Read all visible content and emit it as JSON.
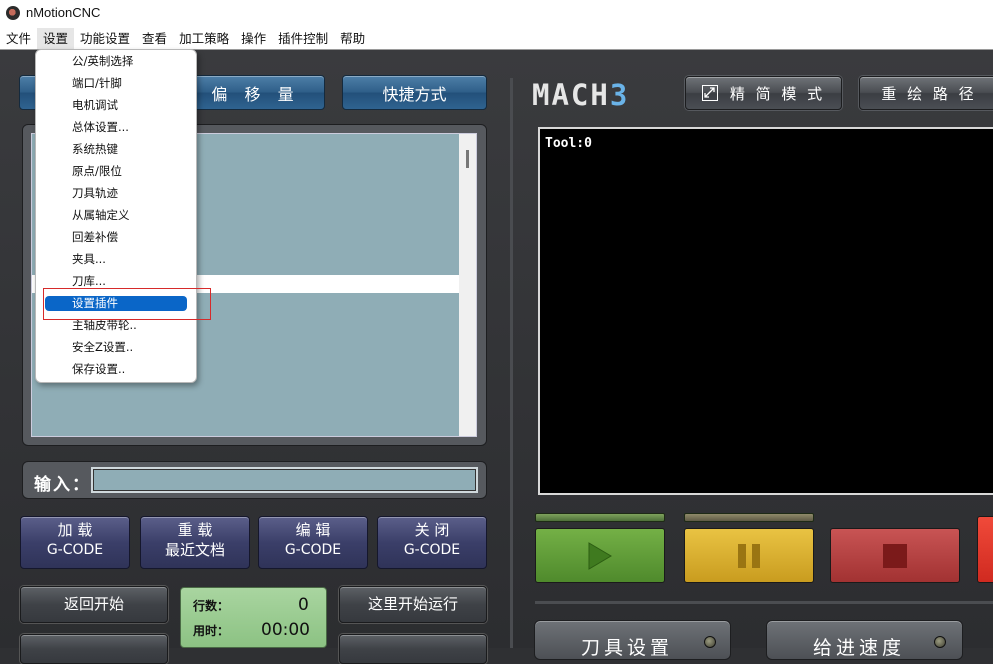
{
  "app": {
    "title": "nMotionCNC"
  },
  "menubar": {
    "items": [
      "文件",
      "设置",
      "功能设置",
      "查看",
      "加工策略",
      "操作",
      "插件控制",
      "帮助"
    ]
  },
  "settings_menu": {
    "items": [
      "公/英制选择",
      "端口/针脚",
      "电机调试",
      "总体设置...",
      "系统热键",
      "原点/限位",
      "刀具轨迹",
      "从属轴定义",
      "回差补偿",
      "夹具...",
      "刀库...",
      "设置插件",
      "主轴皮带轮..",
      "安全Z设置..",
      "保存设置.."
    ],
    "selected": "设置插件"
  },
  "top_buttons": {
    "offset": "偏 移 量",
    "shortcuts": "快捷方式"
  },
  "logo": {
    "main": "MACH",
    "accent": "3"
  },
  "view_buttons": {
    "simple_mode": "精 简 模 式",
    "redraw_path": "重 绘 路 径"
  },
  "input": {
    "label": "输入：",
    "value": ""
  },
  "file_buttons": [
    {
      "line1": "加 载",
      "line2": "G-CODE"
    },
    {
      "line1": "重 载",
      "line2": "最近文档"
    },
    {
      "line1": "编 辑",
      "line2": "G-CODE"
    },
    {
      "line1": "关 闭",
      "line2": "G-CODE"
    }
  ],
  "control_buttons": {
    "return_start": "返回开始",
    "run_from_here": "这里开始运行"
  },
  "stats": {
    "line_label": "行数：",
    "line_value": "0",
    "time_label": "用时：",
    "time_value": "00:00"
  },
  "screen": {
    "tool_text": "Tool:0"
  },
  "bottom_buttons": {
    "tool_setup": "刀具设置",
    "feed_rate": "给进速度"
  },
  "colors": {
    "accent_blue": "#0a66c8",
    "panel_teal": "#8fadb6",
    "highlight_red": "#d62a2a"
  }
}
